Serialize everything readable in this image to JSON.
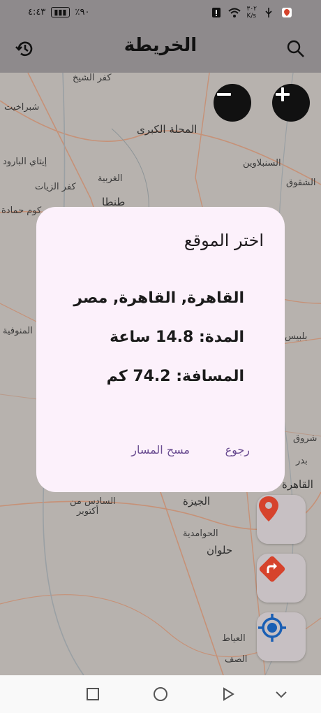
{
  "status": {
    "time": "٤:٤٣",
    "battery_percent": "٪٩٠",
    "network_speed_value": "٣٠٢",
    "network_speed_unit": "K/s"
  },
  "app_bar": {
    "title": "الخريطة",
    "history_icon": "history-icon",
    "search_icon": "search-icon"
  },
  "map": {
    "labels": [
      "كفر الشيخ",
      "شبراخيت",
      "المحلة الكبرى",
      "السنبلاوين",
      "إيتاي البارود",
      "كفر الزيات",
      "الغربية",
      "كوم حمادة",
      "طنطا",
      "الشقوق",
      "بلبيس",
      "المنوفية",
      "السادس من",
      "أكتوبر",
      "الجيزة",
      "الحوامدية",
      "حلوان",
      "العياط",
      "الصف",
      "القاهرة",
      "شروق",
      "بدر"
    ],
    "zoom_in_icon": "plus-icon",
    "zoom_out_icon": "minus-icon"
  },
  "dialog": {
    "title": "اختر الموقع",
    "location": "القاهرة, القاهرة, مصر",
    "duration": "المدة: 14.8 ساعة",
    "distance": "المسافة: 74.2 كم",
    "back_label": "رجوع",
    "clear_route_label": "مسح المسار"
  },
  "fabs": {
    "location_pin_icon": "location-pin-icon",
    "directions_icon": "directions-icon",
    "my_location_icon": "my-location-icon"
  },
  "colors": {
    "accent": "#6a4c91",
    "pin_red": "#d6432c",
    "locate_blue": "#1a5fb4"
  }
}
